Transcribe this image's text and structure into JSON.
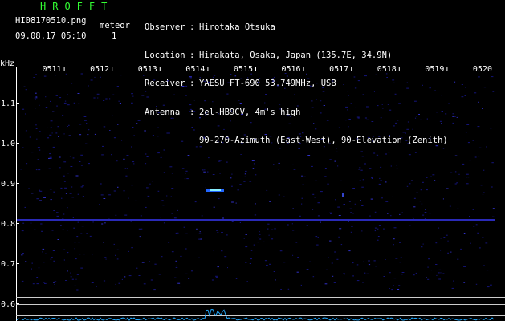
{
  "app": {
    "title": "HROFFT"
  },
  "file": {
    "name": "HI08170510.png",
    "datetime": "09.08.17 05:10"
  },
  "meteor": {
    "label": "meteor",
    "count": "1"
  },
  "info": [
    {
      "key": "Observer",
      "sep": ":",
      "value": "Hirotaka Otsuka"
    },
    {
      "key": "Location",
      "sep": ":",
      "value": "Hirakata, Osaka, Japan (135.7E, 34.9N)"
    },
    {
      "key": "Receiver",
      "sep": ":",
      "value": "YAESU FT-690 53.749MHz, USB"
    },
    {
      "key": "Antenna",
      "sep": ":",
      "value": "2el-HB9CV, 4m's high"
    },
    {
      "key": "",
      "sep": "",
      "value": "90-270-Azimuth (East-West), 90-Elevation (Zenith)"
    }
  ],
  "spectrogram": {
    "y_unit": "kHz",
    "y_ticks": [
      "1.1",
      "1.0",
      "0.9",
      "0.8",
      "0.7",
      "0.6"
    ],
    "x_ticks": [
      "0511",
      "0512",
      "0513",
      "0514",
      "0515",
      "0516",
      "0517",
      "0518",
      "0519",
      "0520"
    ],
    "colors": {
      "background": "#000000",
      "axis": "#ffffff",
      "noise": "#1a1aa0",
      "signal": "#66e0ff",
      "title": "#33ff33"
    }
  }
}
